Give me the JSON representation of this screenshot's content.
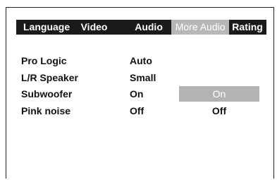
{
  "tabs": [
    {
      "label": "Language"
    },
    {
      "label": "Video"
    },
    {
      "label": "Audio"
    },
    {
      "label": "More Audio"
    },
    {
      "label": "Rating"
    }
  ],
  "settings": [
    {
      "label": "Pro Logic",
      "value": "Auto"
    },
    {
      "label": "L/R Speaker",
      "value": "Small"
    },
    {
      "label": "Subwoofer",
      "value": "On"
    },
    {
      "label": "Pink noise",
      "value": "Off"
    }
  ],
  "options": {
    "selected": "On",
    "other": "Off"
  },
  "colors": {
    "tab_bar": "#1a1a1a",
    "active_tab": "#b7b7b7",
    "highlight": "#b3b3b3"
  }
}
